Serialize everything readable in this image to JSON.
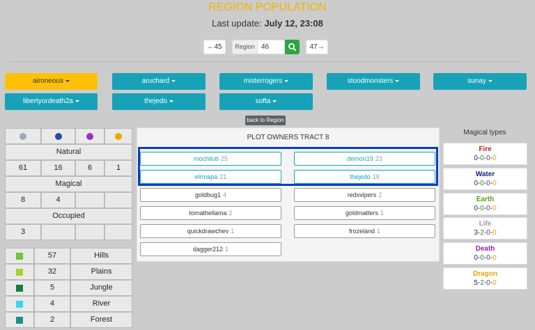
{
  "header": {
    "title": "REGION POPULATION",
    "update_label": "Last update:",
    "update_value": "July 12, 23:08"
  },
  "nav": {
    "prev_label": "←45",
    "region_label": "Region",
    "region_value": "46",
    "search_icon": "search-icon",
    "next_label": "47→"
  },
  "users": [
    {
      "label": "aironeous",
      "active": true
    },
    {
      "label": "aruchard",
      "active": false
    },
    {
      "label": "misterrogers",
      "active": false
    },
    {
      "label": "stoodmonsters",
      "active": false
    },
    {
      "label": "sunay",
      "active": false
    },
    {
      "label": "libertyordeath2a",
      "active": false
    },
    {
      "label": "thejedo",
      "active": false
    },
    {
      "label": "softa",
      "active": false
    }
  ],
  "back_label": "back to Region",
  "stats": {
    "dot_colors": [
      "#9aaabb",
      "#1f4fa8",
      "#9b30c0",
      "#e8a800"
    ],
    "natural_label": "Natural",
    "natural": [
      "61",
      "16",
      "6",
      "1"
    ],
    "magical_label": "Magical",
    "magical": [
      "8",
      "4",
      "",
      ""
    ],
    "occupied_label": "Occupied",
    "occupied": [
      "3",
      "",
      "",
      ""
    ]
  },
  "terrain": [
    {
      "color": "#76c043",
      "count": "57",
      "name": "Hills"
    },
    {
      "color": "#a6d12e",
      "count": "32",
      "name": "Plains"
    },
    {
      "color": "#1b7a43",
      "count": "5",
      "name": "Jungle"
    },
    {
      "color": "#3fd4ee",
      "count": "4",
      "name": "River"
    },
    {
      "color": "#1c8f8a",
      "count": "2",
      "name": "Forest"
    }
  ],
  "panel": {
    "title": "PLOT OWNERS TRACT 8",
    "owners": [
      {
        "name": "mochilub",
        "count": "25"
      },
      {
        "name": "demon19",
        "count": "23"
      },
      {
        "name": "elrmapa",
        "count": "21"
      },
      {
        "name": "thejedo",
        "count": "18"
      },
      {
        "name": "goldbug1",
        "count": "4"
      },
      {
        "name": "redxvipers",
        "count": "2"
      },
      {
        "name": "tomathellama",
        "count": "2"
      },
      {
        "name": "goldmatters",
        "count": "1"
      },
      {
        "name": "quickdrawchev",
        "count": "1"
      },
      {
        "name": "frozeland",
        "count": "1"
      },
      {
        "name": "dagger212",
        "count": "1"
      }
    ]
  },
  "magical_types": {
    "title": "Magical types",
    "types": [
      {
        "name": "Fire",
        "color": "#b71c1c",
        "values": [
          "0",
          "0",
          "0",
          "0"
        ]
      },
      {
        "name": "Water",
        "color": "#1a237e",
        "values": [
          "0",
          "0",
          "0",
          "0"
        ]
      },
      {
        "name": "Earth",
        "color": "#5a9e1a",
        "values": [
          "0",
          "0",
          "0",
          "0"
        ]
      },
      {
        "name": "Life",
        "color": "#9e9e9e",
        "values": [
          "3",
          "2",
          "0",
          "0"
        ]
      },
      {
        "name": "Death",
        "color": "#8e24aa",
        "values": [
          "0",
          "0",
          "0",
          "0"
        ]
      },
      {
        "name": "Dragon",
        "color": "#e0a800",
        "values": [
          "5",
          "2",
          "0",
          "0"
        ]
      }
    ]
  }
}
